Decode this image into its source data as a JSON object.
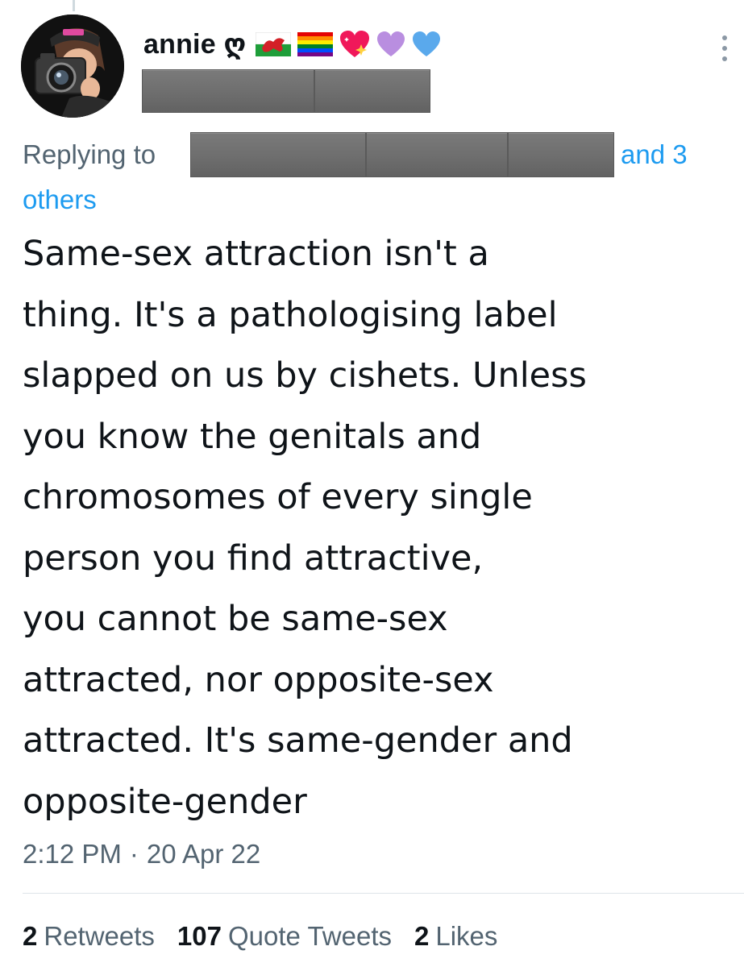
{
  "author": {
    "display_name": "annie ღ",
    "badges": [
      "wales-flag-icon",
      "rainbow-flag-icon",
      "sparkling-heart-icon",
      "purple-heart-icon",
      "blue-heart-icon"
    ],
    "handle_redacted": true
  },
  "reply": {
    "prefix": "Replying to",
    "suffix": "and 3",
    "others": "others",
    "recipients_redacted": true
  },
  "tweet": {
    "lines": [
      "Same-sex attraction isn't a",
      "thing. It's a pathologising label",
      "slapped on us by cishets. Unless",
      "you know the genitals and",
      "chromosomes of every single",
      "person you find attractive,",
      "you cannot be same-sex",
      "attracted, nor opposite-sex",
      "attracted. It's same-gender and",
      "opposite-gender"
    ],
    "time": "2:12 PM",
    "separator": "·",
    "date": "20 Apr 22"
  },
  "stats": {
    "retweets_count": "2",
    "retweets_label": "Retweets",
    "quotes_count": "107",
    "quotes_label": "Quote Tweets",
    "likes_count": "2",
    "likes_label": "Likes"
  },
  "colors": {
    "text": "#0f1419",
    "muted": "#536471",
    "link": "#1d9bf0",
    "redaction": "#6e6e6e"
  }
}
